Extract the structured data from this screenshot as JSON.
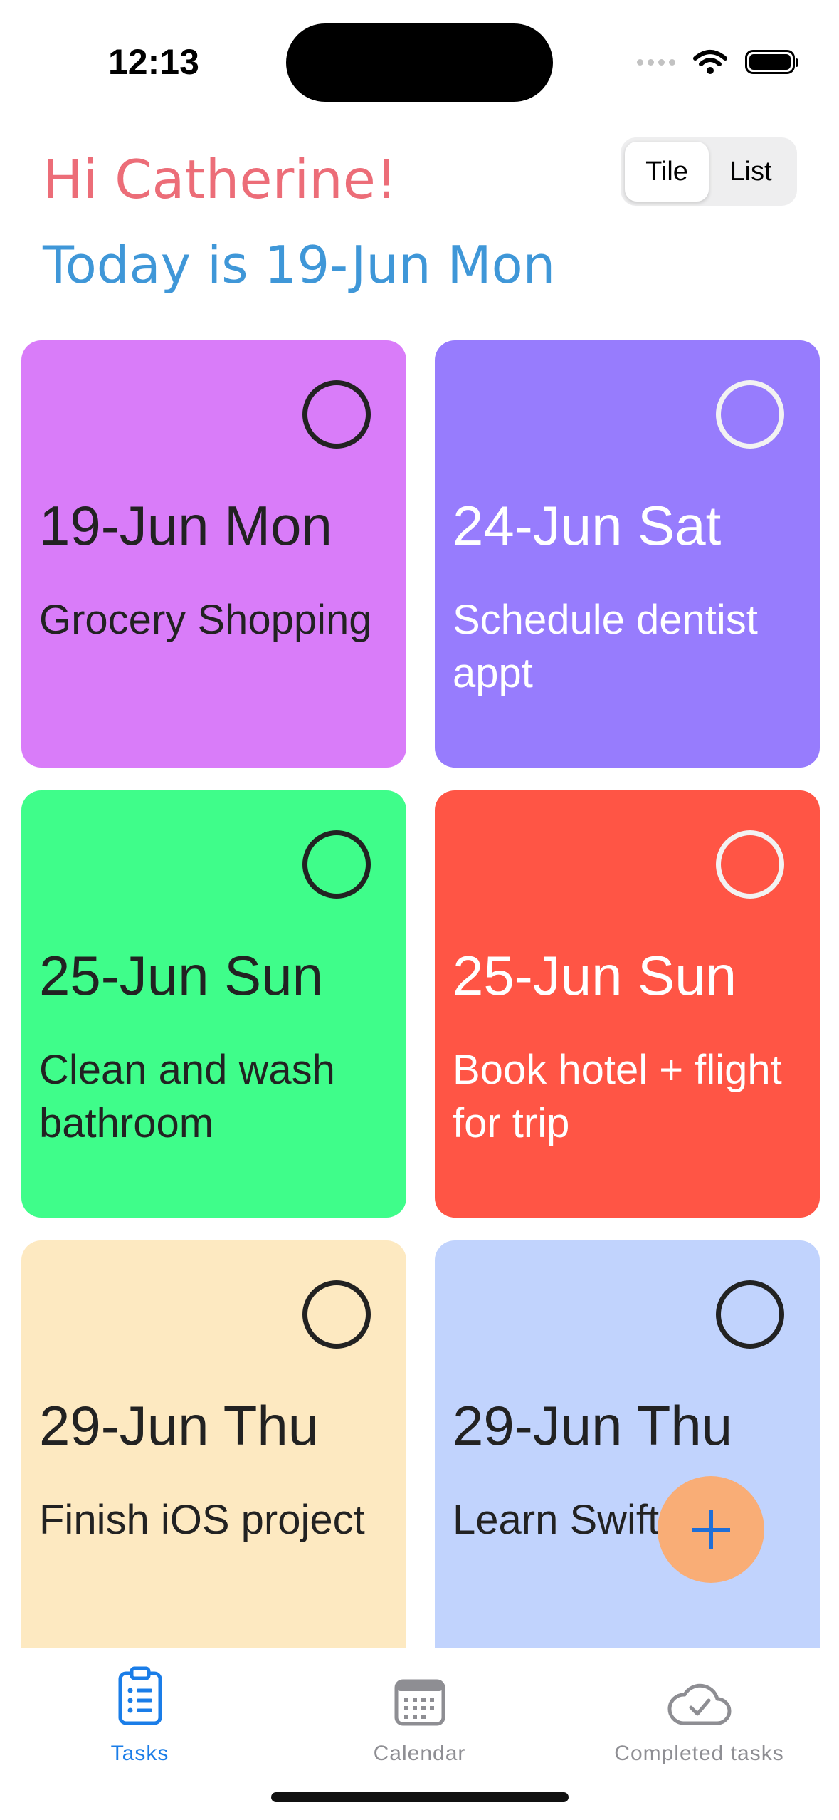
{
  "status_bar": {
    "time": "12:13"
  },
  "header": {
    "greeting": "Hi Catherine!",
    "today": "Today is 19-Jun Mon",
    "view_toggle": {
      "options": [
        "Tile",
        "List"
      ],
      "selected": "Tile"
    }
  },
  "tasks": [
    {
      "date": "19-Jun Mon",
      "title": "Grocery Shopping",
      "color": "#d97cf9",
      "text_style": "dark"
    },
    {
      "date": "24-Jun Sat",
      "title": "Schedule dentist appt",
      "color": "#977cfd",
      "text_style": "light"
    },
    {
      "date": "25-Jun Sun",
      "title": "Clean and wash bathroom",
      "color": "#3ffd8a",
      "text_style": "dark"
    },
    {
      "date": "25-Jun Sun",
      "title": "Book hotel + flight for trip",
      "color": "#ff5545",
      "text_style": "light"
    },
    {
      "date": "29-Jun Thu",
      "title": "Finish iOS project",
      "color": "#fde9c1",
      "text_style": "dark"
    },
    {
      "date": "29-Jun Thu",
      "title": "Learn Swift",
      "color": "#c1d3fd",
      "text_style": "dark"
    }
  ],
  "fab": {
    "icon": "plus-icon",
    "color": "#f9ad76"
  },
  "tab_bar": {
    "tabs": [
      {
        "label": "Tasks",
        "icon": "clipboard-list-icon",
        "active": true
      },
      {
        "label": "Calendar",
        "icon": "calendar-icon",
        "active": false
      },
      {
        "label": "Completed tasks",
        "icon": "cloud-check-icon",
        "active": false
      }
    ],
    "accent": "#1a7de8"
  }
}
